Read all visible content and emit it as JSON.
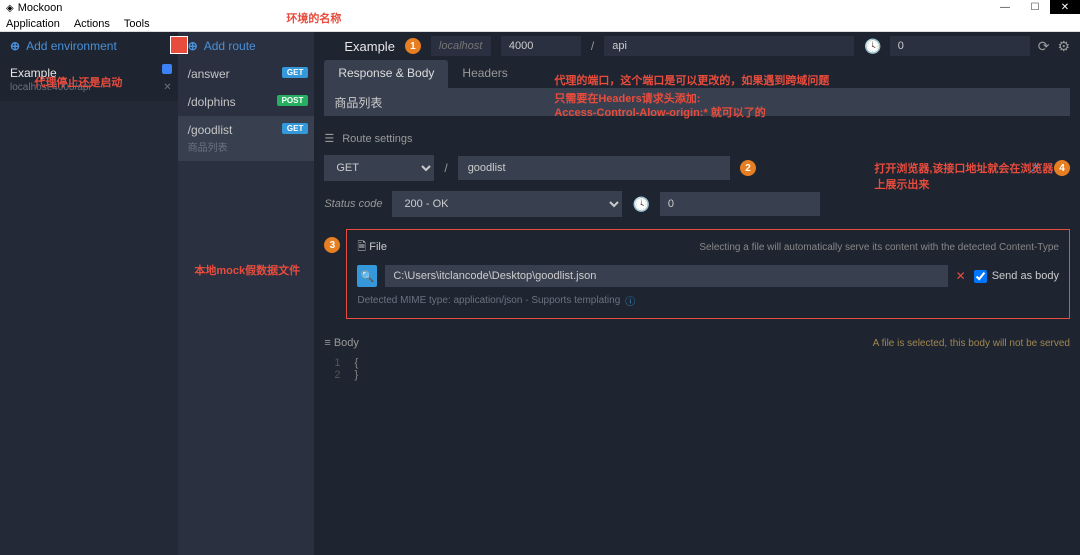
{
  "window": {
    "title": "Mockoon"
  },
  "menu": {
    "application": "Application",
    "actions": "Actions",
    "tools": "Tools"
  },
  "sidebar": {
    "add_env": "Add environment",
    "env": {
      "name": "Example",
      "subtitle": "localhost:4000/api"
    }
  },
  "routes": {
    "add_route": "Add route",
    "items": [
      {
        "path": "/answer",
        "method": "GET"
      },
      {
        "path": "/dolphins",
        "method": "POST"
      },
      {
        "path": "/goodlist",
        "method": "GET",
        "desc": "商品列表",
        "active": true
      }
    ]
  },
  "topbar": {
    "env_name": "Example",
    "host_placeholder": "localhost:",
    "port": "4000",
    "slash": "/",
    "prefix": "api",
    "latency": "0"
  },
  "tabs": {
    "response_body": "Response & Body",
    "headers": "Headers"
  },
  "doc": {
    "value": "商品列表"
  },
  "route_settings": {
    "label": "Route settings",
    "method": "GET",
    "slash": "/",
    "path": "goodlist"
  },
  "status": {
    "label": "Status code",
    "value": "200 - OK",
    "latency": "0"
  },
  "file": {
    "label": "File",
    "hint": "Selecting a file will automatically serve its content with the detected Content-Type",
    "path": "C:\\Users\\itclancode\\Desktop\\goodlist.json",
    "send_as_body": "Send as body",
    "mime": "Detected MIME type: application/json - Supports templating"
  },
  "body": {
    "label": "Body",
    "warn": "A file is selected, this body will not be served",
    "lines": [
      "{",
      "}"
    ]
  },
  "annotations": {
    "a_env_name": "环境的名称",
    "a_toggle": "代理停止还是启动",
    "a_port_line1": "代理的端口，这个端口是可以更改的，如果遇到跨域问题",
    "a_port_line2a": "只需要在Headers请求头添加:",
    "a_port_line2b": "Access-Control-Alow-origin:* 就可以了的",
    "a_open": "打开浏览器,该接口地址就会在浏览器上展示出来",
    "a_file": "本地mock假数据文件"
  }
}
